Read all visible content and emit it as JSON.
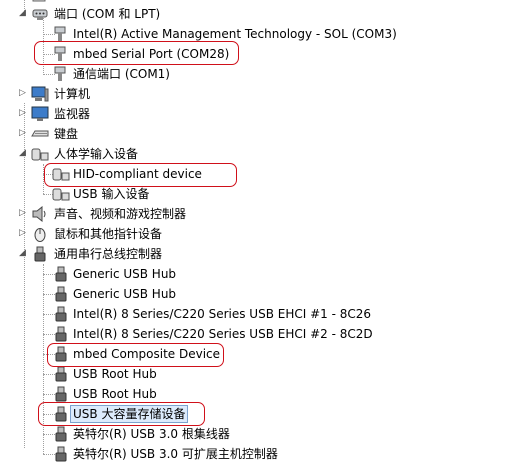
{
  "tree": {
    "ports_category": {
      "label": "端口 (COM 和 LPT)",
      "icon": "port-icon",
      "expanded": true
    },
    "ports": [
      {
        "label": "Intel(R) Active Management Technology - SOL (COM3)",
        "icon": "port-plug-icon"
      },
      {
        "label": "mbed Serial Port (COM28)",
        "icon": "port-plug-icon",
        "highlighted": true
      },
      {
        "label": "通信端口 (COM1)",
        "icon": "port-plug-icon"
      }
    ],
    "computer_category": {
      "label": "计算机",
      "icon": "computer-icon",
      "expanded": false
    },
    "monitor_category": {
      "label": "监视器",
      "icon": "monitor-icon",
      "expanded": false
    },
    "keyboard_category": {
      "label": "键盘",
      "icon": "keyboard-icon",
      "expanded": false
    },
    "hid_category": {
      "label": "人体学输入设备",
      "icon": "hid-icon",
      "expanded": true
    },
    "hid": [
      {
        "label": "HID-compliant device",
        "icon": "hid-device-icon",
        "highlighted": true
      },
      {
        "label": "USB 输入设备",
        "icon": "hid-device-icon"
      }
    ],
    "sound_category": {
      "label": "声音、视频和游戏控制器",
      "icon": "speaker-icon",
      "expanded": false
    },
    "mouse_category": {
      "label": "鼠标和其他指针设备",
      "icon": "mouse-icon",
      "expanded": false
    },
    "usb_category": {
      "label": "通用串行总线控制器",
      "icon": "usb-plug-icon",
      "expanded": true
    },
    "usb": [
      {
        "label": "Generic USB Hub",
        "icon": "usb-plug-icon"
      },
      {
        "label": "Generic USB Hub",
        "icon": "usb-plug-icon"
      },
      {
        "label": "Intel(R) 8 Series/C220 Series USB EHCI #1 - 8C26",
        "icon": "usb-plug-icon"
      },
      {
        "label": "Intel(R) 8 Series/C220 Series USB EHCI #2 - 8C2D",
        "icon": "usb-plug-icon"
      },
      {
        "label": "mbed Composite Device",
        "icon": "usb-plug-icon",
        "highlighted": true
      },
      {
        "label": "USB Root Hub",
        "icon": "usb-plug-icon"
      },
      {
        "label": "USB Root Hub",
        "icon": "usb-plug-icon"
      },
      {
        "label": "USB 大容量存储设备",
        "icon": "usb-plug-icon",
        "highlighted": true,
        "selected": true
      },
      {
        "label": "英特尔(R) USB 3.0 根集线器",
        "icon": "usb-plug-icon"
      },
      {
        "label": "英特尔(R) USB 3.0 可扩展主机控制器",
        "icon": "usb-plug-icon"
      }
    ],
    "annotation_color": "#d0101a",
    "selection_color": "#dcebfc"
  }
}
